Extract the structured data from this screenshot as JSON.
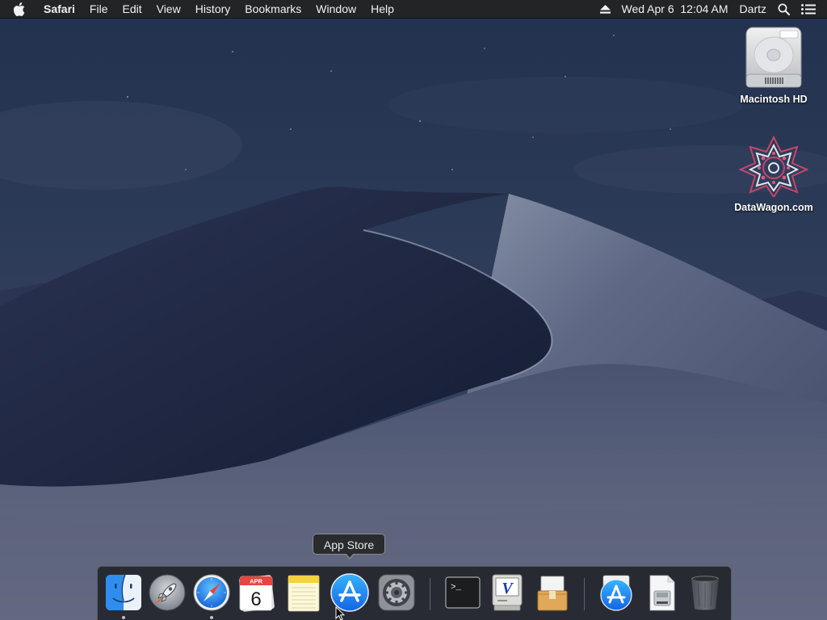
{
  "menubar": {
    "apple_icon": "apple-icon",
    "app_name": "Safari",
    "menus": [
      "File",
      "Edit",
      "View",
      "History",
      "Bookmarks",
      "Window",
      "Help"
    ],
    "eject_icon": "eject-icon",
    "datetime": "Wed Apr 6  12:04 AM",
    "user": "Dartz",
    "search_icon": "spotlight-search-icon",
    "notification_icon": "notification-center-icon"
  },
  "desktop": {
    "icons": [
      {
        "label": "Macintosh HD",
        "icon": "hard-drive-icon"
      },
      {
        "label": "DataWagon.com",
        "icon": "datawagon-logo-icon"
      }
    ]
  },
  "tooltip": {
    "text": "App Store"
  },
  "dock": {
    "items": [
      {
        "name": "Finder",
        "icon": "finder-icon",
        "running": true
      },
      {
        "name": "Launchpad",
        "icon": "launchpad-icon",
        "running": false
      },
      {
        "name": "Safari",
        "icon": "safari-icon",
        "running": true
      },
      {
        "name": "Calendar",
        "icon": "calendar-icon",
        "running": false,
        "month": "APR",
        "day": "6"
      },
      {
        "name": "Notes",
        "icon": "notes-icon",
        "running": false
      },
      {
        "name": "App Store",
        "icon": "app-store-icon",
        "running": false
      },
      {
        "name": "System Preferences",
        "icon": "system-preferences-icon",
        "running": false
      },
      {
        "name": "Terminal",
        "icon": "terminal-icon",
        "running": false,
        "prompt": ">_"
      },
      {
        "name": "Vim",
        "icon": "vim-icon",
        "running": false,
        "letter": "V"
      },
      {
        "name": "Archive",
        "icon": "archive-icon",
        "running": false
      },
      {
        "name": "Downloads",
        "icon": "downloads-stack-icon",
        "running": false
      },
      {
        "name": "Disk Image",
        "icon": "disk-image-icon",
        "running": false
      },
      {
        "name": "Trash",
        "icon": "trash-icon",
        "running": false
      }
    ]
  },
  "colors": {
    "menubar_bg": "#232426",
    "dock_bg": "#202228",
    "sky_top": "#23334f",
    "dune_shadow": "#1b2540",
    "dune_light": "#6c7590"
  }
}
